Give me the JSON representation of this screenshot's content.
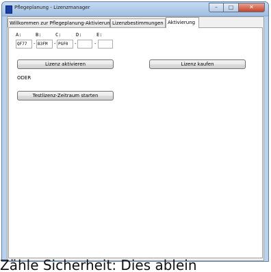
{
  "window": {
    "title": "Pflegeplanung - Lizenzmanager",
    "buttons": {
      "minimize": "–",
      "maximize": "□",
      "close": "✕"
    }
  },
  "tabs": [
    {
      "label": "Willkommen zur Pflegeplanung-Aktivierung",
      "active": false
    },
    {
      "label": "Lizenzbestimmungen",
      "active": false
    },
    {
      "label": "Aktivierung",
      "active": true
    }
  ],
  "license_key": {
    "labels": [
      "A:",
      "B:",
      "C:",
      "D:",
      "E:"
    ],
    "values": [
      "QF77",
      "B3FM",
      "PGF0",
      "",
      ""
    ],
    "separator": "-"
  },
  "buttons": {
    "activate": "Lizenz aktivieren",
    "buy": "Lizenz kaufen",
    "trial": "Testlizenz-Zeitraum starten"
  },
  "or_text": "ODER",
  "footer_overlay_text": "Zähle Sicherheit: Dies ablein"
}
